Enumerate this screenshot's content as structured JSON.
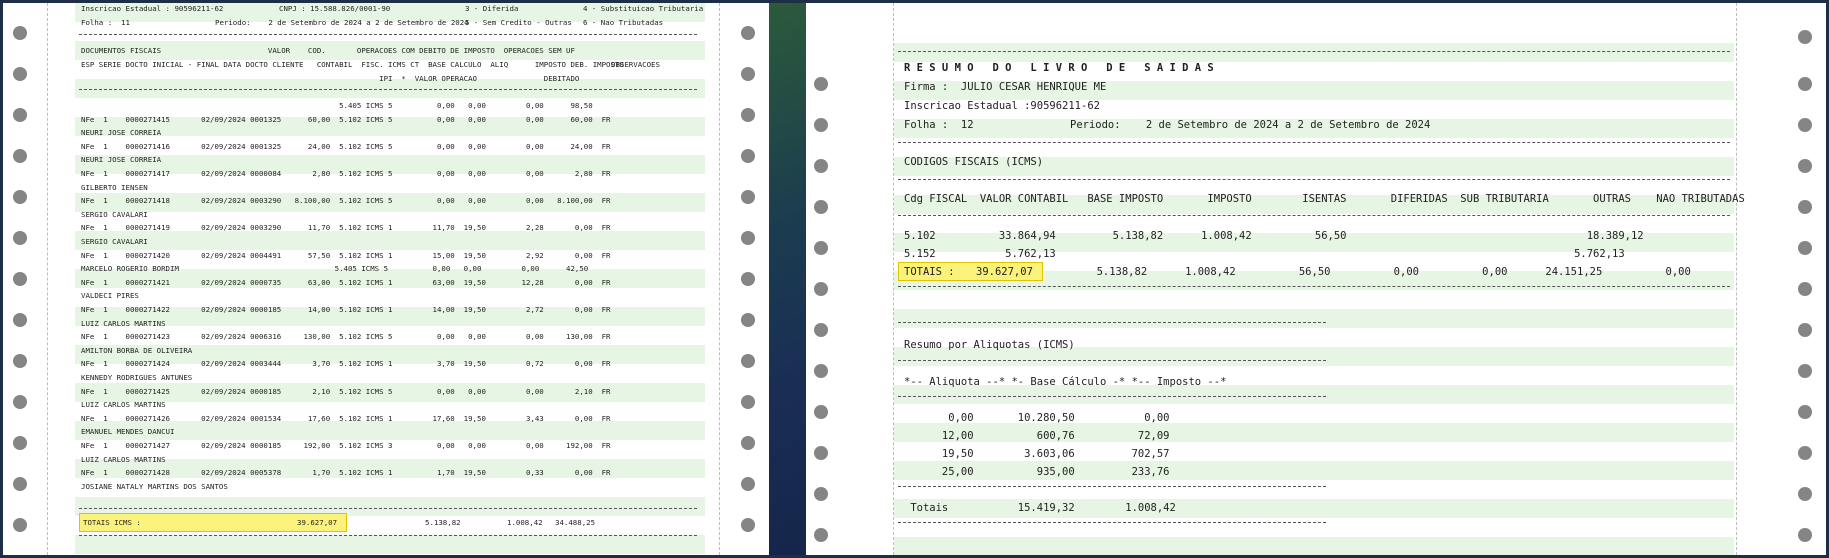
{
  "left_page": {
    "header": {
      "inscricao": "Inscricao Estadual : 90596211-62",
      "cnpj": "CNPJ : 15.588.826/0001-90",
      "legend_3": "3 - Diferida",
      "legend_4": "4 - Substituicao Tributaria",
      "folha": "Folha :  11",
      "periodo": "Periodo:    2 de Setembro de 2024 a 2 de Setembro de 2024",
      "legend_5": "5 - Sem Credito - Outras",
      "legend_6": "6 - Nao Tributadas"
    },
    "column_headers": {
      "row1": "DOCUMENTOS FISCAIS                        VALOR    COD.       OPERACOES COM DEBITO DE IMPOSTO  OPERACOES SEM UF",
      "row1_obs": "OBSERVACOES",
      "row2": "ESP SERIE DOCTO INICIAL - FINAL DATA DOCTO CLIENTE   CONTABIL  FISC. ICMS CT  BASE CALCULO  ALIQ      IMPOSTO DEB. IMPOSTO",
      "row3": "                                                                   IPI  *  VALOR OPERACAO               DEBITADO"
    },
    "lines": [
      {
        "text": "                                                          5.405 ICMS 5          0,00   0,00         0,00      98,50"
      },
      {
        "text": "NFe  1    0000271415       02/09/2024 0001325      60,00  5.102 ICMS 5          0,00   0,00         0,00      60,00  FR"
      },
      {
        "text": "NEURI JOSE CORREIA"
      },
      {
        "text": "NFe  1    0000271416       02/09/2024 0001325      24,00  5.102 ICMS 5          0,00   0,00         0,00      24,00  FR"
      },
      {
        "text": "NEURI JOSE CORREIA"
      },
      {
        "text": "NFe  1    0000271417       02/09/2024 0000084       2,80  5.102 ICMS 5          0,00   0,00         0,00       2,80  FR"
      },
      {
        "text": "GILBERTO IENSEN"
      },
      {
        "text": "NFe  1    0000271418       02/09/2024 0003290   8.100,00  5.102 ICMS 5          0,00   0,00         0,00   8.100,00  FR"
      },
      {
        "text": "SERGIO CAVALARI"
      },
      {
        "text": "NFe  1    0000271419       02/09/2024 0003290      11,70  5.102 ICMS 1         11,70  19,50         2,28       0,00  FR"
      },
      {
        "text": "SERGIO CAVALARI"
      },
      {
        "text": "NFe  1    0000271420       02/09/2024 0004491      57,50  5.102 ICMS 1         15,00  19,50         2,92       0,00  FR"
      },
      {
        "text": "MARCELO ROGERIO BORDIM                                   5.405 ICMS 5          0,00   0,00         0,00      42,50"
      },
      {
        "text": "NFe  1    0000271421       02/09/2024 0000735      63,00  5.102 ICMS 1         63,00  19,50        12,28       0,00  FR"
      },
      {
        "text": "VALDECI PIRES"
      },
      {
        "text": "NFe  1    0000271422       02/09/2024 0000185      14,00  5.102 ICMS 1         14,00  19,50         2,72       0,00  FR"
      },
      {
        "text": "LUIZ CARLOS MARTINS"
      },
      {
        "text": "NFe  1    0000271423       02/09/2024 0006316     130,00  5.102 ICMS 5          0,00   0,00         0,00     130,00  FR"
      },
      {
        "text": "AMILTON BORBA DE OLIVEIRA"
      },
      {
        "text": "NFe  1    0000271424       02/09/2024 0003444       3,70  5.102 ICMS 1          3,70  19,50         0,72       0,00  FR"
      },
      {
        "text": "KENNEDY RODRIGUES ANTUNES"
      },
      {
        "text": "NFe  1    0000271425       02/09/2024 0000185       2,10  5.102 ICMS 5          0,00   0,00         0,00       2,10  FR"
      },
      {
        "text": "LUIZ CARLOS MARTINS"
      },
      {
        "text": "NFe  1    0000271426       02/09/2024 0001534      17,60  5.102 ICMS 1         17,60  19,50         3,43       0,00  FR"
      },
      {
        "text": "EMANUEL MENDES DANCUI"
      },
      {
        "text": "NFe  1    0000271427       02/09/2024 0000185     192,00  5.102 ICMS 3          0,00   0,00         0,00     192,00  FR"
      },
      {
        "text": "LUIZ CARLOS MARTINS"
      },
      {
        "text": "NFe  1    0000271428       02/09/2024 0005378       1,70  5.102 ICMS 1          1,70  19,50         0,33       0,00  FR"
      },
      {
        "text": "JOSIANE NATALY MARTINS DOS SANTOS"
      }
    ],
    "totals": {
      "label": "TOTAIS ICMS :",
      "valor_contabil": "39.627,07",
      "base": "5.138,82",
      "imposto": "1.008,42",
      "outras": "34.488,25"
    }
  },
  "right_page": {
    "title": "R E S U M O   D O   L I V R O   D E   S A I D A S",
    "firma": "Firma :  JULIO CESAR HENRIQUE ME",
    "inscricao": "Inscricao Estadual :90596211-62",
    "folha": "Folha :  12",
    "periodo": "Periodo:    2 de Setembro de 2024 a 2 de Setembro de 2024",
    "section_cfop": "CODIGOS FISCAIS (ICMS)",
    "cfop_header": "Cdg FISCAL  VALOR CONTABIL   BASE IMPOSTO       IMPOSTO        ISENTAS       DIFERIDAS  SUB TRIBUTARIA       OUTRAS    NAO TRIBUTADAS",
    "cfop_rows": [
      {
        "text": "5.102          33.864,94         5.138,82      1.008,42          56,50                                      18.389,12"
      },
      {
        "text": "5.152           5.762,13                                                                                  5.762,13"
      }
    ],
    "cfop_totals": {
      "label": "TOTAIS :",
      "valor": "39.627,07",
      "rest": "        5.138,82      1.008,42          56,50          0,00          0,00      24.151,25          0,00"
    },
    "section_aliquotas": "Resumo por Aliquotas (ICMS)",
    "aliq_header": "*-- Aliquota --* *- Base Cálculo -* *-- Imposto --*",
    "aliq_rows": [
      {
        "text": "       0,00       10.280,50           0,00"
      },
      {
        "text": "      12,00          600,76          72,09"
      },
      {
        "text": "      19,50        3.603,06         702,57"
      },
      {
        "text": "      25,00          935,00         233,76"
      }
    ],
    "aliq_totals": " Totais           15.419,32        1.008,42"
  }
}
